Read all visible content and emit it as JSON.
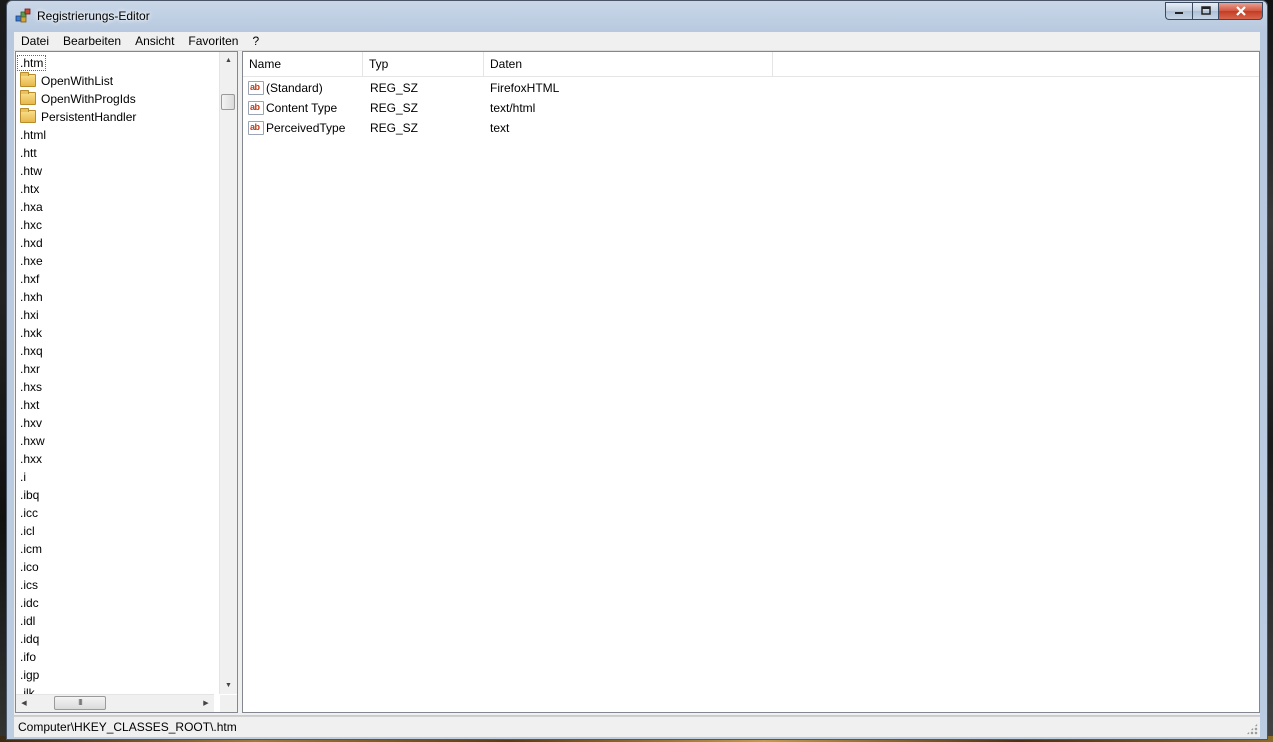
{
  "window": {
    "title": "Registrierungs-Editor"
  },
  "menu": [
    "Datei",
    "Bearbeiten",
    "Ansicht",
    "Favoriten",
    "?"
  ],
  "tree": {
    "items": [
      {
        "label": ".htm",
        "indent": 0,
        "folder": false,
        "selected": true
      },
      {
        "label": "OpenWithList",
        "indent": 1,
        "folder": true,
        "selected": false
      },
      {
        "label": "OpenWithProgIds",
        "indent": 1,
        "folder": true,
        "selected": false
      },
      {
        "label": "PersistentHandler",
        "indent": 1,
        "folder": true,
        "selected": false
      },
      {
        "label": ".html",
        "indent": 0,
        "folder": false,
        "selected": false
      },
      {
        "label": ".htt",
        "indent": 0,
        "folder": false,
        "selected": false
      },
      {
        "label": ".htw",
        "indent": 0,
        "folder": false,
        "selected": false
      },
      {
        "label": ".htx",
        "indent": 0,
        "folder": false,
        "selected": false
      },
      {
        "label": ".hxa",
        "indent": 0,
        "folder": false,
        "selected": false
      },
      {
        "label": ".hxc",
        "indent": 0,
        "folder": false,
        "selected": false
      },
      {
        "label": ".hxd",
        "indent": 0,
        "folder": false,
        "selected": false
      },
      {
        "label": ".hxe",
        "indent": 0,
        "folder": false,
        "selected": false
      },
      {
        "label": ".hxf",
        "indent": 0,
        "folder": false,
        "selected": false
      },
      {
        "label": ".hxh",
        "indent": 0,
        "folder": false,
        "selected": false
      },
      {
        "label": ".hxi",
        "indent": 0,
        "folder": false,
        "selected": false
      },
      {
        "label": ".hxk",
        "indent": 0,
        "folder": false,
        "selected": false
      },
      {
        "label": ".hxq",
        "indent": 0,
        "folder": false,
        "selected": false
      },
      {
        "label": ".hxr",
        "indent": 0,
        "folder": false,
        "selected": false
      },
      {
        "label": ".hxs",
        "indent": 0,
        "folder": false,
        "selected": false
      },
      {
        "label": ".hxt",
        "indent": 0,
        "folder": false,
        "selected": false
      },
      {
        "label": ".hxv",
        "indent": 0,
        "folder": false,
        "selected": false
      },
      {
        "label": ".hxw",
        "indent": 0,
        "folder": false,
        "selected": false
      },
      {
        "label": ".hxx",
        "indent": 0,
        "folder": false,
        "selected": false
      },
      {
        "label": ".i",
        "indent": 0,
        "folder": false,
        "selected": false
      },
      {
        "label": ".ibq",
        "indent": 0,
        "folder": false,
        "selected": false
      },
      {
        "label": ".icc",
        "indent": 0,
        "folder": false,
        "selected": false
      },
      {
        "label": ".icl",
        "indent": 0,
        "folder": false,
        "selected": false
      },
      {
        "label": ".icm",
        "indent": 0,
        "folder": false,
        "selected": false
      },
      {
        "label": ".ico",
        "indent": 0,
        "folder": false,
        "selected": false
      },
      {
        "label": ".ics",
        "indent": 0,
        "folder": false,
        "selected": false
      },
      {
        "label": ".idc",
        "indent": 0,
        "folder": false,
        "selected": false
      },
      {
        "label": ".idl",
        "indent": 0,
        "folder": false,
        "selected": false
      },
      {
        "label": ".idq",
        "indent": 0,
        "folder": false,
        "selected": false
      },
      {
        "label": ".ifo",
        "indent": 0,
        "folder": false,
        "selected": false
      },
      {
        "label": ".igp",
        "indent": 0,
        "folder": false,
        "selected": false
      },
      {
        "label": ".ilk",
        "indent": 0,
        "folder": false,
        "selected": false
      }
    ],
    "hscroll_thumb_glyph": "III"
  },
  "list": {
    "columns": [
      "Name",
      "Typ",
      "Daten"
    ],
    "rows": [
      {
        "name": "(Standard)",
        "type": "REG_SZ",
        "data": "FirefoxHTML"
      },
      {
        "name": "Content Type",
        "type": "REG_SZ",
        "data": "text/html"
      },
      {
        "name": "PerceivedType",
        "type": "REG_SZ",
        "data": "text"
      }
    ],
    "value_icon_text": "ab"
  },
  "status": {
    "path": "Computer\\HKEY_CLASSES_ROOT\\.htm"
  }
}
